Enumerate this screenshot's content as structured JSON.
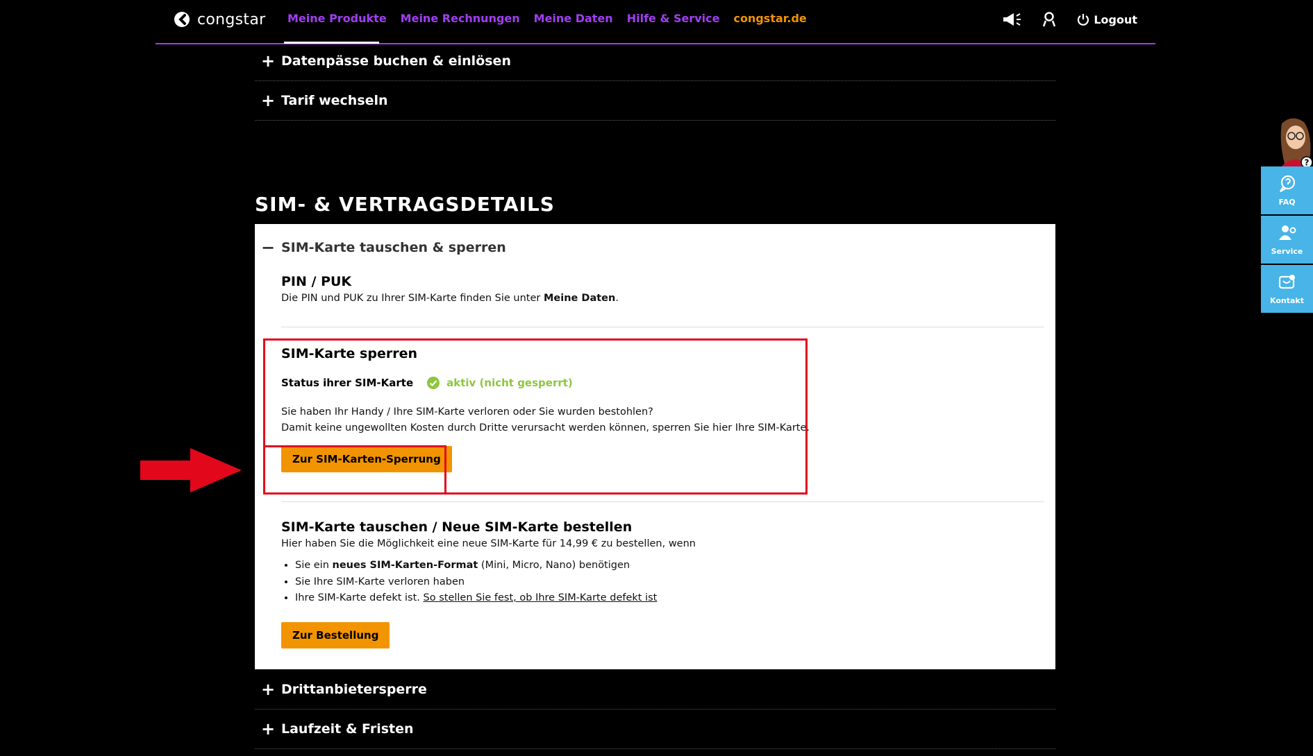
{
  "header": {
    "logo_text": "congstar",
    "nav": [
      {
        "label": "Meine Produkte"
      },
      {
        "label": "Meine Rechnungen"
      },
      {
        "label": "Meine Daten"
      },
      {
        "label": "Hilfe & Service"
      },
      {
        "label": "congstar.de"
      }
    ],
    "logout_label": "Logout"
  },
  "accordion_top": [
    {
      "label": "Datenpässe buchen & einlösen"
    },
    {
      "label": "Tarif wechseln"
    }
  ],
  "section_title": "SIM- & VERTRAGSDETAILS",
  "panel": {
    "header_label": "SIM-Karte tauschen & sperren",
    "pin_puk": {
      "title": "PIN / PUK",
      "text_prefix": "Die PIN und PUK zu Ihrer SIM-Karte finden Sie unter ",
      "text_bold": "Meine Daten",
      "text_suffix": "."
    },
    "sim_lock": {
      "title": "SIM-Karte sperren",
      "status_label": "Status ihrer SIM-Karte",
      "status_value": "aktiv (nicht gesperrt)",
      "line1": "Sie haben Ihr Handy / Ihre SIM-Karte verloren oder Sie wurden bestohlen?",
      "line2": "Damit keine ungewollten Kosten durch Dritte verursacht werden können, sperren Sie hier Ihre SIM-Karte.",
      "button_label": "Zur SIM-Karten-Sperrung"
    },
    "sim_swap": {
      "title": "SIM-Karte tauschen / Neue SIM-Karte bestellen",
      "intro": "Hier haben Sie die Möglichkeit eine neue SIM-Karte für 14,99 € zu bestellen, wenn",
      "b1_prefix": "Sie ein ",
      "b1_bold": "neues SIM-Karten-Format",
      "b1_suffix": " (Mini, Micro, Nano) benötigen",
      "b2": "Sie Ihre SIM-Karte verloren haben",
      "b3_prefix": "Ihre SIM-Karte defekt ist. ",
      "b3_link": "So stellen Sie fest, ob Ihre SIM-Karte defekt ist",
      "button_label": "Zur Bestellung"
    }
  },
  "accordion_bottom": [
    {
      "label": "Drittanbietersperre"
    },
    {
      "label": "Laufzeit & Fristen"
    }
  ],
  "side_widget": {
    "tabs": [
      {
        "label": "FAQ"
      },
      {
        "label": "Service"
      },
      {
        "label": "Kontakt"
      }
    ]
  }
}
